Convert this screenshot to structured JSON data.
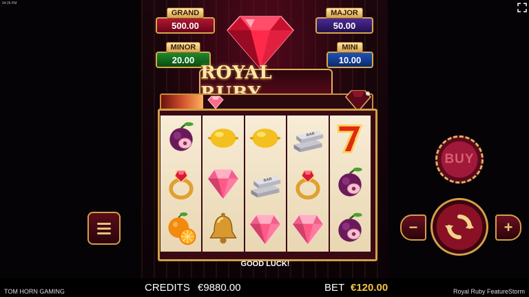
{
  "status_bar": {
    "time": "04:26 PM"
  },
  "jackpots": {
    "grand": {
      "label": "GRAND",
      "value": "500.00"
    },
    "major": {
      "label": "MAJOR",
      "value": "50.00"
    },
    "minor": {
      "label": "MINOR",
      "value": "20.00"
    },
    "mini": {
      "label": "MINI",
      "value": "10.00"
    }
  },
  "logo": {
    "title": "ROYAL RUBY"
  },
  "progress": {
    "fraction": 0.2
  },
  "reels": [
    [
      "plum",
      "ring",
      "orange"
    ],
    [
      "lemon",
      "ruby",
      "bell"
    ],
    [
      "lemon",
      "silver-bars",
      "ruby"
    ],
    [
      "silver-bars",
      "ring",
      "ruby"
    ],
    [
      "seven",
      "plum",
      "plum"
    ]
  ],
  "reel_symbol_labels": {
    "silver_bars_text": "BAR"
  },
  "message": "GOOD LUCK!",
  "controls": {
    "buy_label": "BUY",
    "minus_label": "−",
    "plus_label": "+"
  },
  "footer": {
    "brand": "TOM HORN GAMING",
    "credits_label": "CREDITS",
    "credits_value": "€9880.00",
    "bet_label": "BET",
    "bet_value": "€120.00",
    "game_name": "Royal Ruby FeatureStorm"
  },
  "colors": {
    "gold": "#d3a04a",
    "ruby": "#d81b3a",
    "accent_bet": "#f4c542"
  }
}
